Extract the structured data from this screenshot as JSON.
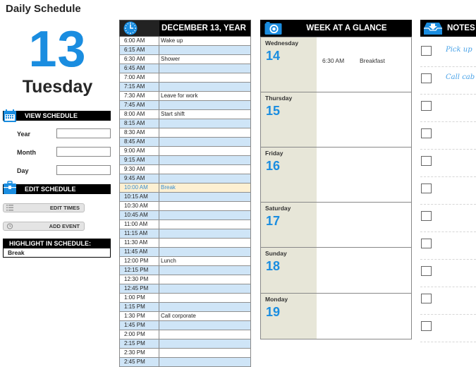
{
  "app": {
    "title": "Daily Schedule"
  },
  "today": {
    "day_number": "13",
    "weekday": "Tuesday"
  },
  "view_schedule": {
    "header": "VIEW SCHEDULE",
    "fields": [
      {
        "label": "Year",
        "value": ""
      },
      {
        "label": "Month",
        "value": ""
      },
      {
        "label": "Day",
        "value": ""
      }
    ]
  },
  "edit_schedule": {
    "header": "EDIT SCHEDULE",
    "buttons": [
      {
        "label": "EDIT TIMES",
        "icon": "list-icon"
      },
      {
        "label": "ADD EVENT",
        "icon": "clock-icon"
      }
    ]
  },
  "highlight": {
    "header": "HIGHLIGHT IN SCHEDULE:",
    "value": "Break"
  },
  "schedule": {
    "title": "DECEMBER 13, YEAR",
    "highlight_color": "#fdf0d2",
    "rows": [
      {
        "time": "6:00 AM",
        "event": "Wake up"
      },
      {
        "time": "6:15 AM",
        "event": ""
      },
      {
        "time": "6:30 AM",
        "event": "Shower"
      },
      {
        "time": "6:45 AM",
        "event": ""
      },
      {
        "time": "7:00 AM",
        "event": ""
      },
      {
        "time": "7:15 AM",
        "event": ""
      },
      {
        "time": "7:30 AM",
        "event": "Leave for work"
      },
      {
        "time": "7:45 AM",
        "event": ""
      },
      {
        "time": "8:00 AM",
        "event": "Start shift"
      },
      {
        "time": "8:15 AM",
        "event": ""
      },
      {
        "time": "8:30 AM",
        "event": ""
      },
      {
        "time": "8:45 AM",
        "event": ""
      },
      {
        "time": "9:00 AM",
        "event": ""
      },
      {
        "time": "9:15 AM",
        "event": ""
      },
      {
        "time": "9:30 AM",
        "event": ""
      },
      {
        "time": "9:45 AM",
        "event": ""
      },
      {
        "time": "10:00 AM",
        "event": "Break",
        "highlighted": true
      },
      {
        "time": "10:15 AM",
        "event": ""
      },
      {
        "time": "10:30 AM",
        "event": ""
      },
      {
        "time": "10:45 AM",
        "event": ""
      },
      {
        "time": "11:00 AM",
        "event": ""
      },
      {
        "time": "11:15 AM",
        "event": ""
      },
      {
        "time": "11:30 AM",
        "event": ""
      },
      {
        "time": "11:45 AM",
        "event": ""
      },
      {
        "time": "12:00 PM",
        "event": "Lunch"
      },
      {
        "time": "12:15 PM",
        "event": ""
      },
      {
        "time": "12:30 PM",
        "event": ""
      },
      {
        "time": "12:45 PM",
        "event": ""
      },
      {
        "time": "1:00 PM",
        "event": ""
      },
      {
        "time": "1:15 PM",
        "event": ""
      },
      {
        "time": "1:30 PM",
        "event": "Call corporate"
      },
      {
        "time": "1:45 PM",
        "event": ""
      },
      {
        "time": "2:00 PM",
        "event": ""
      },
      {
        "time": "2:15 PM",
        "event": ""
      },
      {
        "time": "2:30 PM",
        "event": ""
      },
      {
        "time": "2:45 PM",
        "event": ""
      }
    ]
  },
  "week": {
    "title": "WEEK AT A GLANCE",
    "days": [
      {
        "name": "Wednesday",
        "number": "14",
        "event_time": "6:30 AM",
        "event_text": "Breakfast"
      },
      {
        "name": "Thursday",
        "number": "15",
        "event_time": "",
        "event_text": ""
      },
      {
        "name": "Friday",
        "number": "16",
        "event_time": "",
        "event_text": ""
      },
      {
        "name": "Saturday",
        "number": "17",
        "event_time": "",
        "event_text": ""
      },
      {
        "name": "Sunday",
        "number": "18",
        "event_time": "",
        "event_text": ""
      },
      {
        "name": "Monday",
        "number": "19",
        "event_time": "",
        "event_text": ""
      }
    ]
  },
  "notes": {
    "title": "NOTES",
    "items": [
      {
        "text": "Pick up",
        "checked": false
      },
      {
        "text": "Call cab",
        "checked": false
      },
      {
        "text": "",
        "checked": false
      },
      {
        "text": "",
        "checked": false
      },
      {
        "text": "",
        "checked": false
      },
      {
        "text": "",
        "checked": false
      },
      {
        "text": "",
        "checked": false
      },
      {
        "text": "",
        "checked": false
      },
      {
        "text": "",
        "checked": false
      },
      {
        "text": "",
        "checked": false
      },
      {
        "text": "",
        "checked": false
      }
    ]
  },
  "colors": {
    "accent": "#1a8de0",
    "header_bg": "#000000",
    "row_alt": "#cfe5f7",
    "week_side": "#e7e6d8"
  }
}
